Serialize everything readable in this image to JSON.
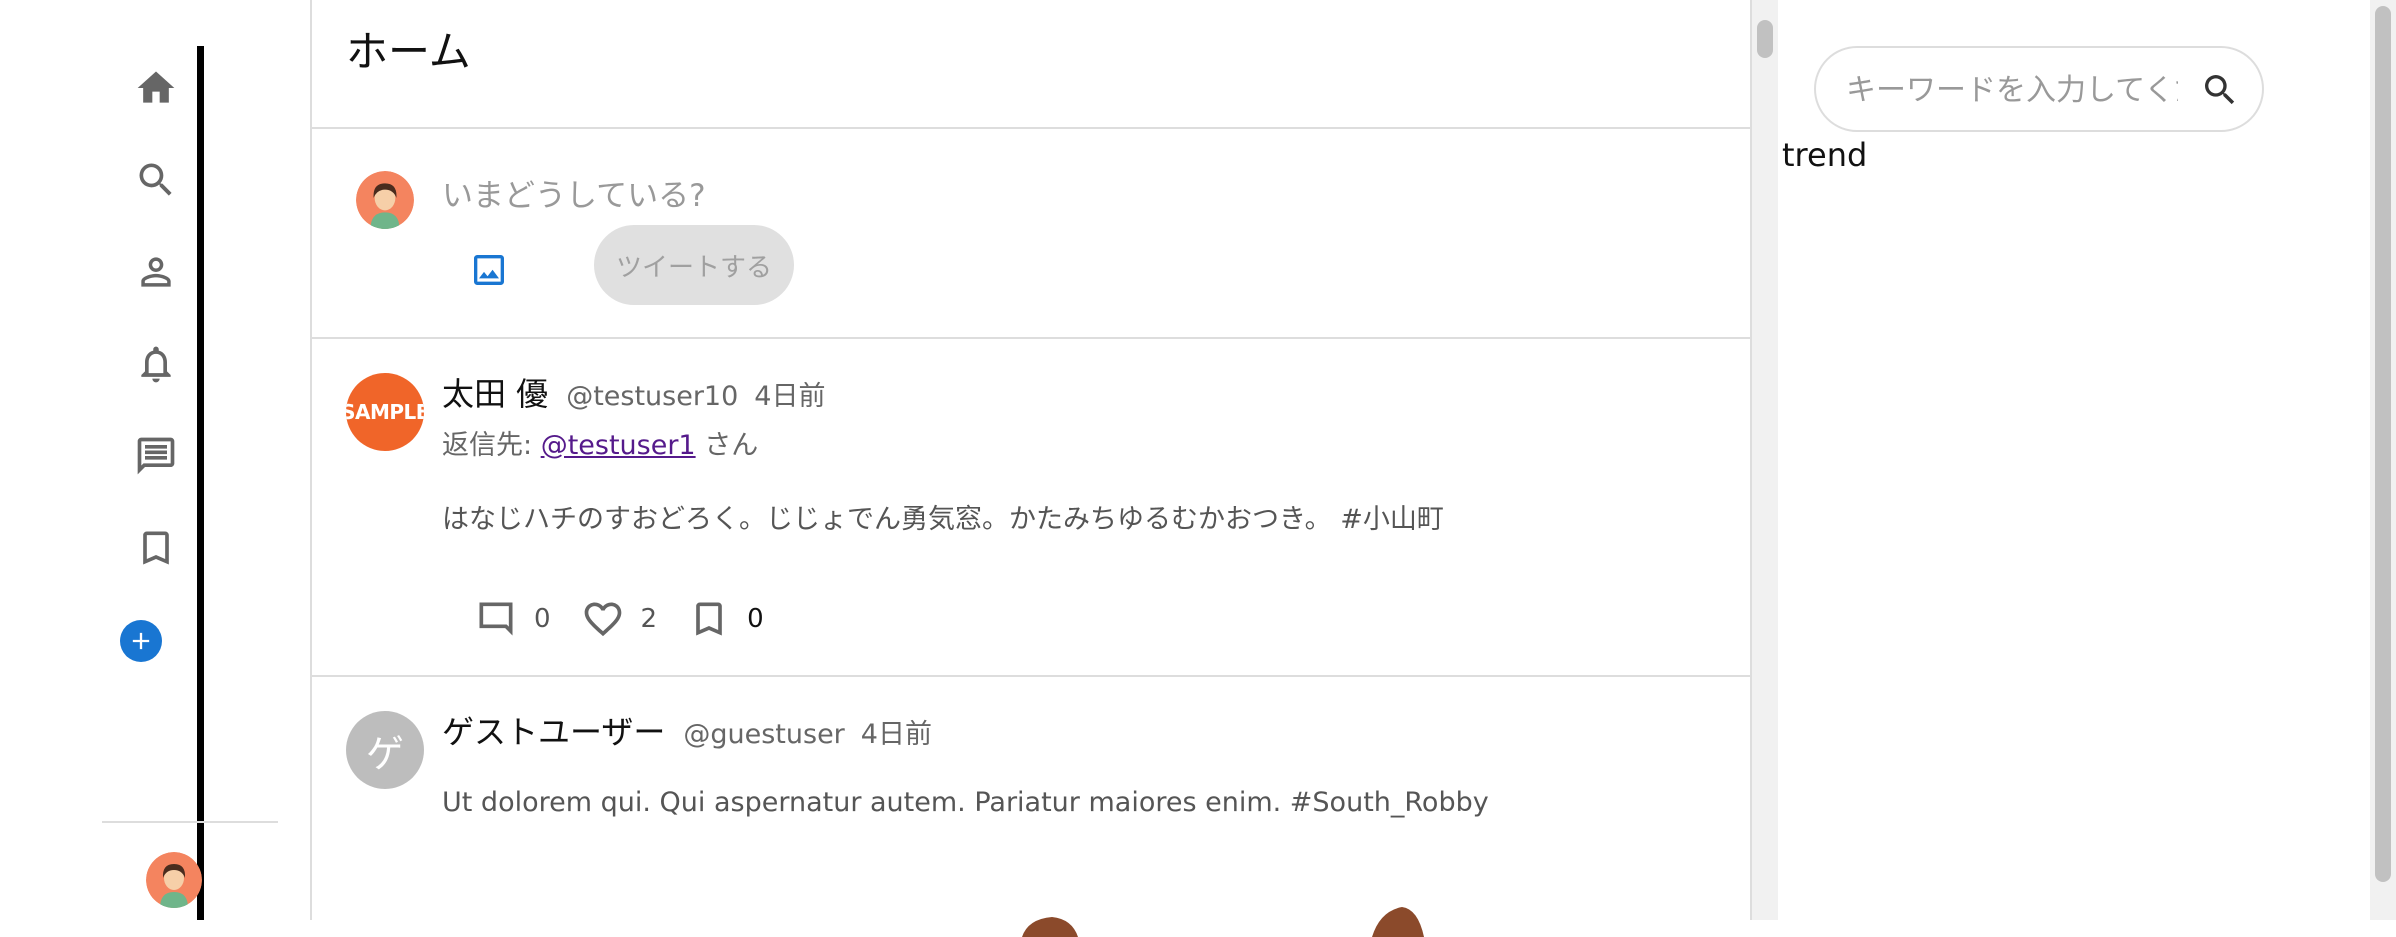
{
  "sidebar": {
    "items": [
      {
        "icon": "home-icon"
      },
      {
        "icon": "search-icon"
      },
      {
        "icon": "person-icon"
      },
      {
        "icon": "bell-icon"
      },
      {
        "icon": "message-icon"
      },
      {
        "icon": "bookmark-icon"
      }
    ],
    "add_icon": "add-circle-icon"
  },
  "header": {
    "title": "ホーム"
  },
  "compose": {
    "placeholder": "いまどうしている?",
    "tweet_button": "ツイートする"
  },
  "tweets": [
    {
      "avatar_text": "SAMPLE",
      "name": "太田 優",
      "handle": "@testuser10",
      "time": "4日前",
      "reply_prefix": "返信先: ",
      "reply_handle": "@testuser1",
      "reply_suffix": " さん",
      "body": "はなじハチのすおどろく。じじょでん勇気窓。かたみちゆるむかおつき。 #小山町",
      "comments": "0",
      "likes": "2",
      "bookmarks": "0"
    },
    {
      "avatar_text": "ゲ",
      "name": "ゲストユーザー",
      "handle": "@guestuser",
      "time": "4日前",
      "body": "Ut dolorem qui. Qui aspernatur autem. Pariatur maiores enim. #South_Robby"
    }
  ],
  "right": {
    "search_placeholder": "キーワードを入力してください",
    "trend_label": "trend"
  },
  "colors": {
    "accent": "#1976d2",
    "divider": "#dddddd",
    "sample_avatar": "#f06529",
    "guest_avatar": "#bdbdbd"
  }
}
